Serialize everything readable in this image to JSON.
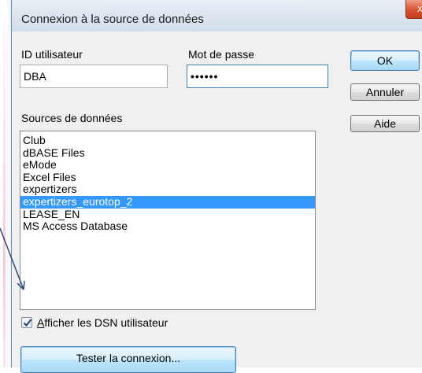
{
  "dialog": {
    "title": "Connexion à la source de données",
    "close_label": "x"
  },
  "form": {
    "user_id_label": "ID utilisateur",
    "user_id_value": "DBA",
    "password_label": "Mot de passe",
    "password_value": "••••••",
    "sources_label": "Sources de données"
  },
  "buttons": {
    "ok": "OK",
    "cancel": "Annuler",
    "help": "Aide",
    "test_connection": "Tester la connexion..."
  },
  "data_sources": {
    "items": [
      "Club",
      "dBASE Files",
      "eMode",
      "Excel Files",
      "expertizers",
      "expertizers_eurotop_2",
      "LEASE_EN",
      "MS Access Database"
    ],
    "selected": "expertizers_eurotop_2"
  },
  "options": {
    "show_user_dsn_label_prefix": "A",
    "show_user_dsn_label_rest": "fficher les DSN utilisateur",
    "show_user_dsn_checked": true
  },
  "colors": {
    "selection": "#3399ff",
    "arrow": "#2a4a7a",
    "close_button": "#d9532f"
  }
}
